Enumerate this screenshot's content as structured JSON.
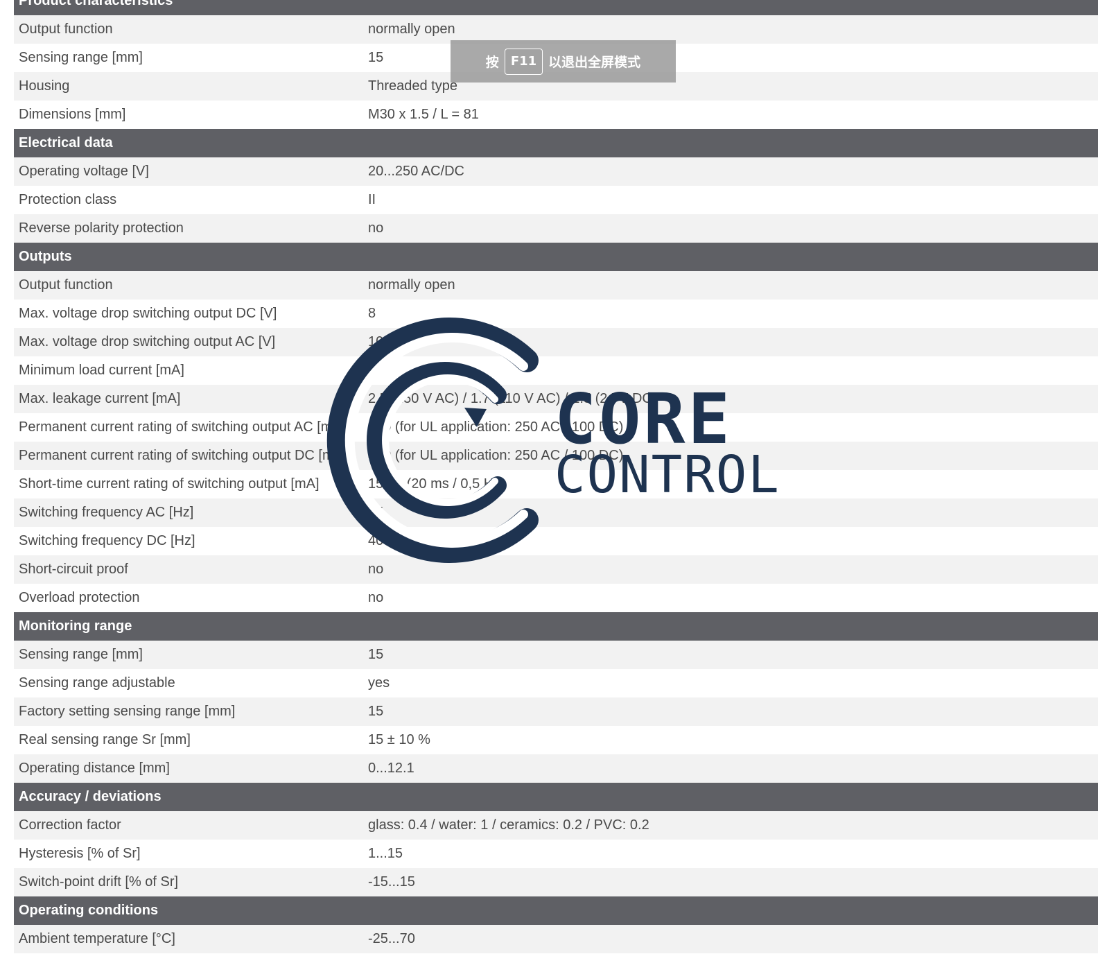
{
  "sections": [
    {
      "title": "Product characteristics",
      "rows": [
        {
          "label": "Output function",
          "value": "normally open"
        },
        {
          "label": "Sensing range [mm]",
          "value": "15"
        },
        {
          "label": "Housing",
          "value": "Threaded type"
        },
        {
          "label": "Dimensions [mm]",
          "value": "M30 x 1.5 / L = 81"
        }
      ]
    },
    {
      "title": "Electrical data",
      "rows": [
        {
          "label": "Operating voltage [V]",
          "value": "20...250 AC/DC"
        },
        {
          "label": "Protection class",
          "value": "II"
        },
        {
          "label": "Reverse polarity protection",
          "value": "no"
        }
      ]
    },
    {
      "title": "Outputs",
      "rows": [
        {
          "label": "Output function",
          "value": "normally open"
        },
        {
          "label": "Max. voltage drop switching output DC [V]",
          "value": "8"
        },
        {
          "label": "Max. voltage drop switching output AC [V]",
          "value": "10"
        },
        {
          "label": "Minimum load current [mA]",
          "value": "5"
        },
        {
          "label": "Max. leakage current [mA]",
          "value": "2.5 (250 V AC) / 1.7 (110 V AC) / 1.5 (24 V DC)"
        },
        {
          "label": "Permanent current rating of switching output AC [mA]",
          "value": "400 (for UL application: 250 AC / 100 DC)"
        },
        {
          "label": "Permanent current rating of switching output DC [mA]",
          "value": "400 (for UL application: 250 AC / 100 DC)"
        },
        {
          "label": "Short-time current rating of switching output [mA]",
          "value": "1500; (20 ms / 0,5 Hz)"
        },
        {
          "label": "Switching frequency AC [Hz]",
          "value": "25"
        },
        {
          "label": "Switching frequency DC [Hz]",
          "value": "40"
        },
        {
          "label": "Short-circuit proof",
          "value": "no"
        },
        {
          "label": "Overload protection",
          "value": "no"
        }
      ]
    },
    {
      "title": "Monitoring range",
      "rows": [
        {
          "label": "Sensing range [mm]",
          "value": "15"
        },
        {
          "label": "Sensing range adjustable",
          "value": "yes"
        },
        {
          "label": "Factory setting sensing range [mm]",
          "value": "15"
        },
        {
          "label": "Real sensing range Sr [mm]",
          "value": "15 ± 10 %"
        },
        {
          "label": "Operating distance [mm]",
          "value": "0...12.1"
        }
      ]
    },
    {
      "title": "Accuracy / deviations",
      "rows": [
        {
          "label": "Correction factor",
          "value": "glass: 0.4 / water: 1 / ceramics: 0.2 / PVC: 0.2"
        },
        {
          "label": "Hysteresis [% of Sr]",
          "value": "1...15"
        },
        {
          "label": "Switch-point drift [% of Sr]",
          "value": "-15...15"
        }
      ]
    },
    {
      "title": "Operating conditions",
      "rows": [
        {
          "label": "Ambient temperature [°C]",
          "value": "-25...70"
        }
      ]
    }
  ],
  "fullscreen_hint": {
    "prefix": "按",
    "key": "F11",
    "suffix": "以退出全屏模式"
  },
  "watermark": {
    "line1": "CORE",
    "line2": "CONTROL",
    "color": "#1e3350"
  },
  "colors": {
    "section_header_bg": "#5f6065",
    "row_alt_bg": "#f2f2f2",
    "text": "#4a4a4a"
  }
}
